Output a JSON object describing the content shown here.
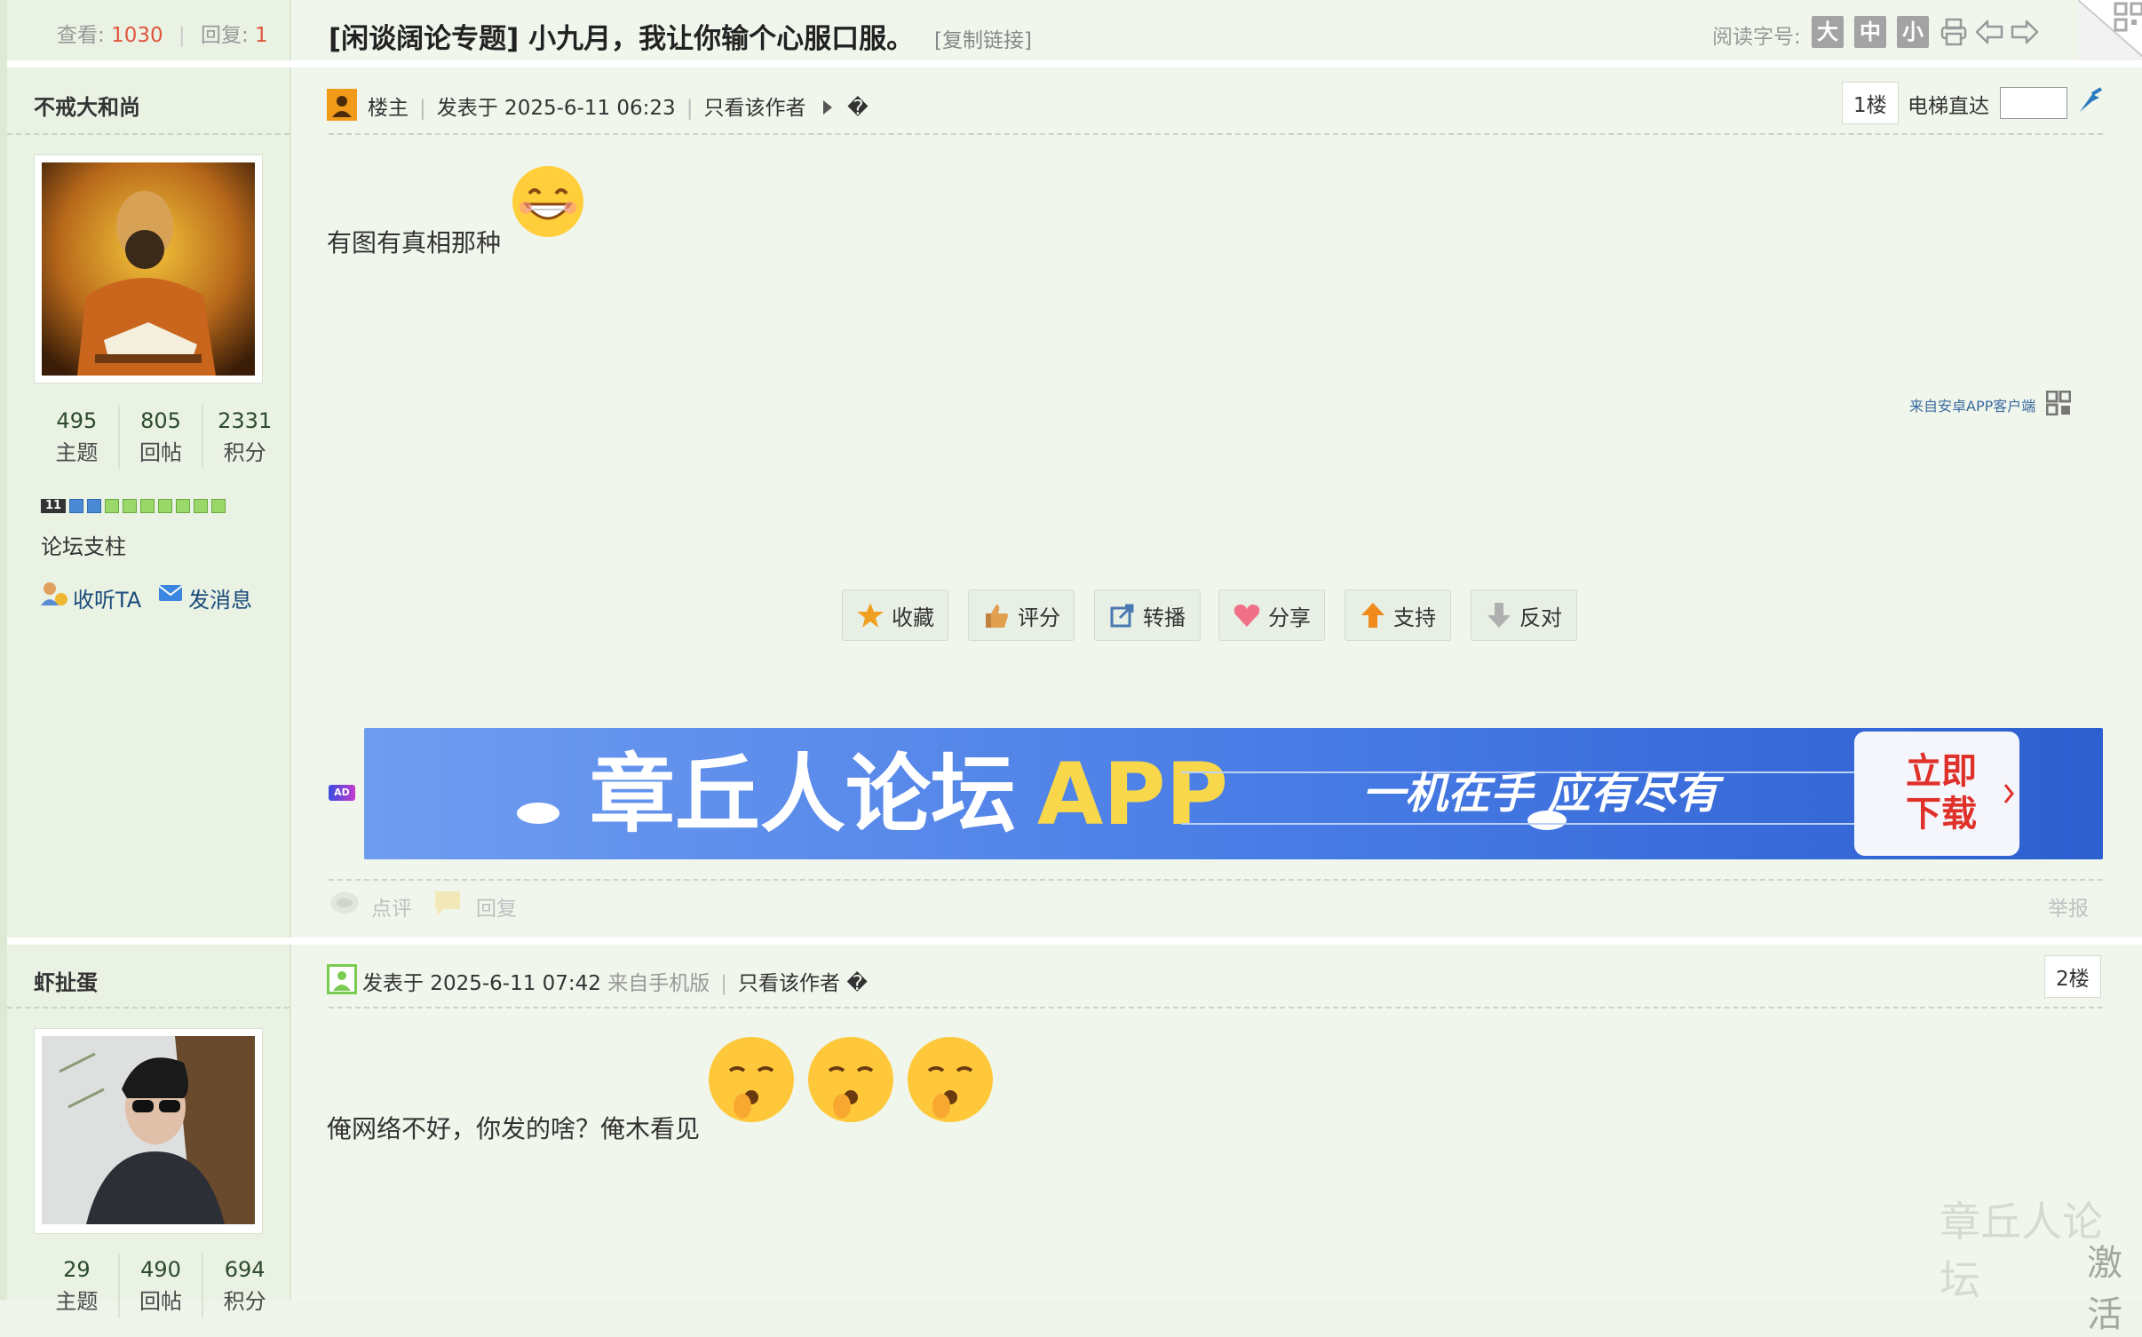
{
  "header": {
    "views_label": "查看:",
    "views_value": "1030",
    "replies_label": "回复:",
    "replies_value": "1",
    "title": "[闲谈阔论专题] 小九月，我让你输个心服口服。",
    "copy_link": "[复制链接]",
    "font_size_label": "阅读字号:",
    "font_large": "大",
    "font_medium": "中",
    "font_small": "小"
  },
  "posts": [
    {
      "author": "不戒大和尚",
      "badge": "楼主",
      "posted": "发表于 2025-6-11 06:23",
      "only_author": "只看该作者",
      "glyph": "�",
      "floor": "1楼",
      "elevator_label": "电梯直达",
      "stats": {
        "topics": "495",
        "topics_label": "主题",
        "replies": "805",
        "replies_label": "回帖",
        "points": "2331",
        "points_label": "积分"
      },
      "level": "11",
      "rank": "论坛支柱",
      "follow": "收听TA",
      "message": "发消息",
      "content": "有图有真相那种",
      "app_note": "来自安卓APP客户端",
      "actions": [
        "收藏",
        "评分",
        "转播",
        "分享",
        "支持",
        "反对"
      ],
      "banner_main": "章丘人论坛",
      "banner_app": "APP",
      "banner_slogan": "一机在手 应有尽有",
      "banner_cta_1": "立即",
      "banner_cta_2": "下载",
      "ad_tag": "AD",
      "comment": "点评",
      "reply": "回复",
      "report": "举报"
    },
    {
      "author": "虾扯蛋",
      "posted": "发表于 2025-6-11 07:42",
      "from_mobile": "来自手机版",
      "only_author": "只看该作者",
      "glyph": "�",
      "floor": "2楼",
      "stats": {
        "topics": "29",
        "topics_label": "主题",
        "replies": "490",
        "replies_label": "回帖",
        "points": "694",
        "points_label": "积分"
      },
      "content": "俺网络不好，你发的啥？俺木看见"
    }
  ],
  "watermark": "章丘人论坛",
  "corner_text": "激活"
}
